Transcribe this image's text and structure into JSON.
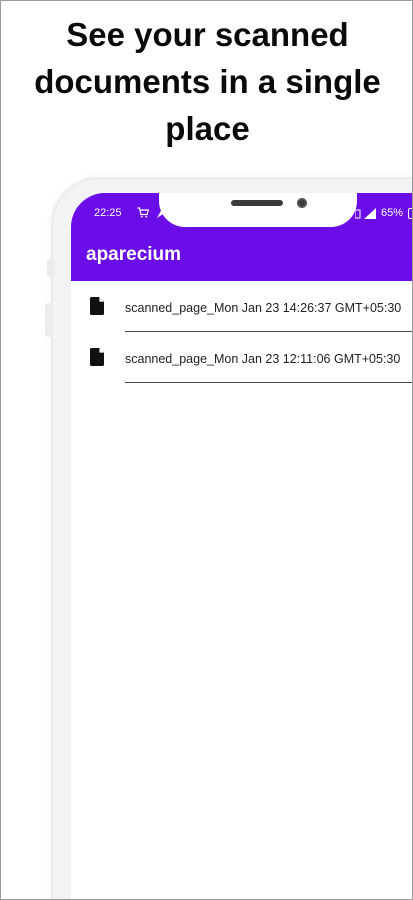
{
  "promo": {
    "headline": "See your scanned documents in a single place"
  },
  "status_bar": {
    "time": "22:25",
    "battery": "65%",
    "left_icons": [
      "cart-icon",
      "navigation-icon"
    ],
    "right_icons": [
      "signal-icon",
      "battery-icon"
    ]
  },
  "app_bar": {
    "title": "aparecium",
    "color": "#6a0de8"
  },
  "documents": [
    {
      "name": "scanned_page_Mon Jan 23 14:26:37 GMT+05:30",
      "icon": "file-icon"
    },
    {
      "name": "scanned_page_Mon Jan 23 12:11:06 GMT+05:30",
      "icon": "file-icon"
    }
  ]
}
